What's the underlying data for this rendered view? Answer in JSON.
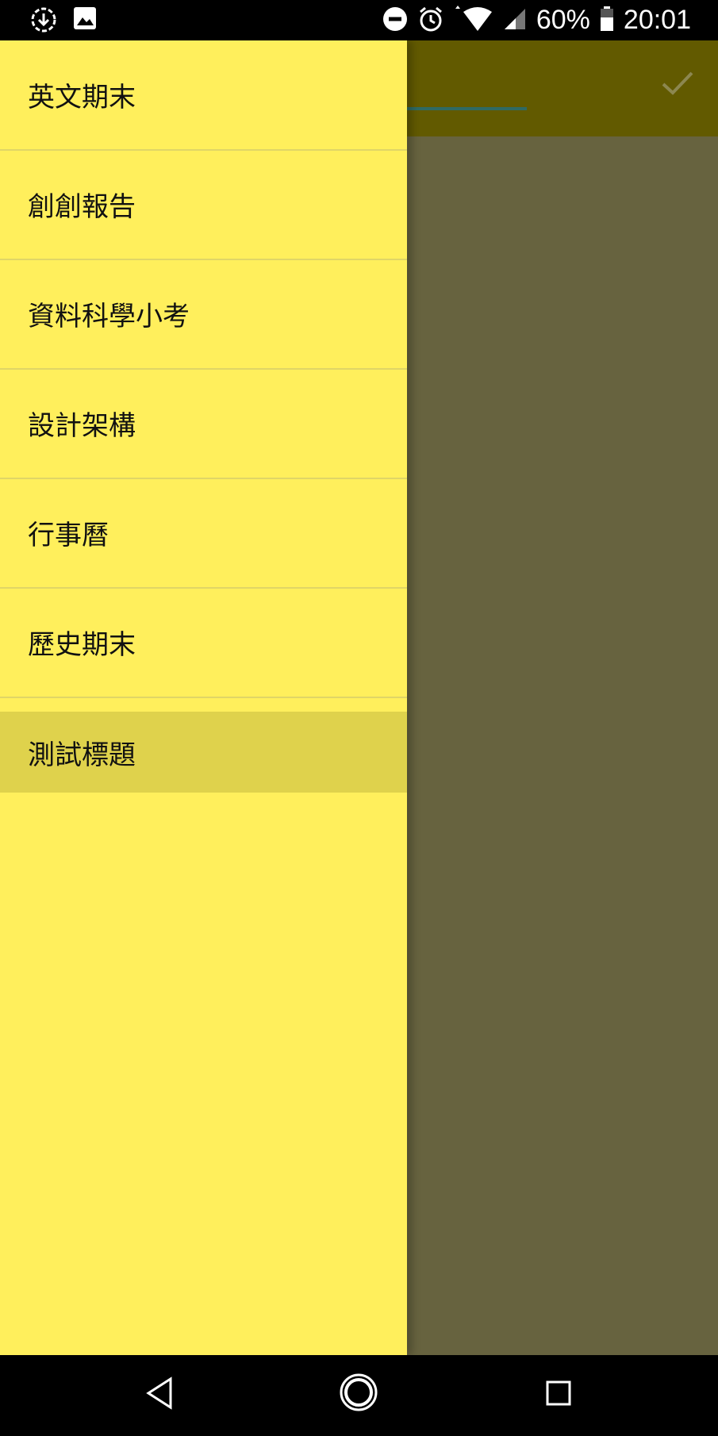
{
  "status_bar": {
    "battery": "60%",
    "time": "20:01",
    "icons": [
      "download-icon",
      "image-icon",
      "dnd-icon",
      "alarm-icon",
      "wifi-icon",
      "signal-icon",
      "battery-icon"
    ]
  },
  "toolbar": {
    "confirm_icon": "check-icon"
  },
  "drawer": {
    "items": [
      {
        "label": "英文期末"
      },
      {
        "label": "創創報告"
      },
      {
        "label": "資料科學小考"
      },
      {
        "label": "設計架構"
      },
      {
        "label": "行事曆"
      },
      {
        "label": "歷史期末"
      },
      {
        "label": "測試標題",
        "selected": true
      }
    ]
  },
  "nav_bar": {
    "icons": [
      "back-icon",
      "home-icon",
      "recents-icon"
    ]
  },
  "colors": {
    "drawer_bg": "#FFEF5C",
    "selected_bg": "#DFD24C",
    "toolbar_bg": "#625A00",
    "scrim_bg": "#67633F"
  }
}
